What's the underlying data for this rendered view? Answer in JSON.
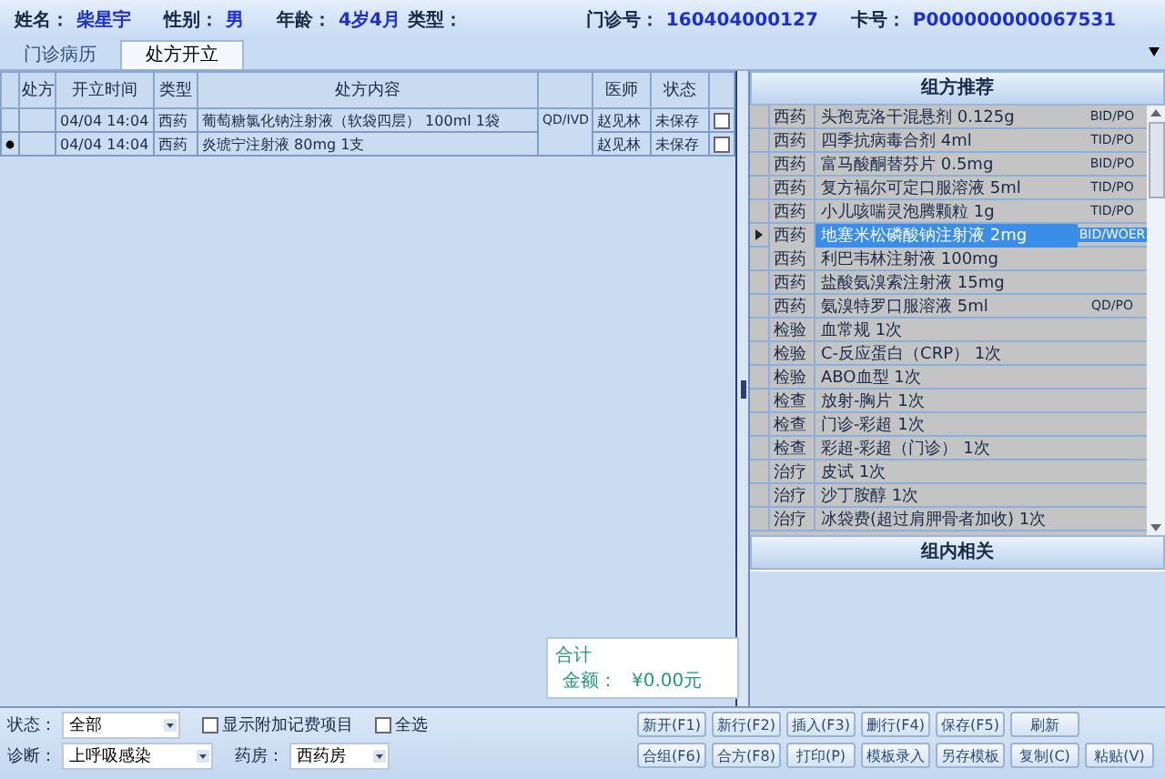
{
  "patient": {
    "name_label": "姓名：",
    "name": "柴星宇",
    "sex_label": "性别：",
    "sex": "男",
    "age_label": "年龄：",
    "age": "4岁4月",
    "type_label": "类型：",
    "clinic_no_label": "门诊号：",
    "clinic_no": "160404000127",
    "card_label": "卡号：",
    "card_no": "P000000000067531"
  },
  "tabs": [
    {
      "label": "门诊病历",
      "selected": false
    },
    {
      "label": "处方开立",
      "selected": true
    }
  ],
  "prescription_table": {
    "columns": [
      "处方",
      "开立时间",
      "类型",
      "处方内容",
      "医师",
      "状态"
    ],
    "rows": [
      {
        "current": false,
        "time": "04/04 14:04",
        "type": "西药",
        "content": "葡萄糖氯化钠注射液（软袋四层）  100ml 1袋",
        "usage": "QD/IVD",
        "doctor": "赵见林",
        "status": "未保存",
        "checked": false
      },
      {
        "current": true,
        "time": "04/04 14:04",
        "type": "西药",
        "content": "炎琥宁注射液  80mg 1支",
        "doctor": "赵见林",
        "status": "未保存",
        "checked": false
      }
    ]
  },
  "total": {
    "label": "合计",
    "amount_label": "金额：",
    "amount": "¥0.00元"
  },
  "recommend": {
    "title": "组方推荐",
    "rows": [
      {
        "type": "西药",
        "content": "头孢克洛干混悬剂  0.125g",
        "usage": "BID/PO",
        "selected": false
      },
      {
        "type": "西药",
        "content": "四季抗病毒合剂  4ml",
        "usage": "TID/PO",
        "selected": false
      },
      {
        "type": "西药",
        "content": "富马酸酮替芬片  0.5mg",
        "usage": "BID/PO",
        "selected": false
      },
      {
        "type": "西药",
        "content": "复方福尔可定口服溶液  5ml",
        "usage": "TID/PO",
        "selected": false
      },
      {
        "type": "西药",
        "content": "小儿咳喘灵泡腾颗粒  1g",
        "usage": "TID/PO",
        "selected": false
      },
      {
        "type": "西药",
        "content": "地塞米松磷酸钠注射液  2mg",
        "usage": "BID/WOER",
        "selected": true
      },
      {
        "type": "西药",
        "content": "利巴韦林注射液  100mg",
        "selected": false
      },
      {
        "type": "西药",
        "content": "盐酸氨溴索注射液  15mg",
        "selected": false
      },
      {
        "type": "西药",
        "content": "氨溴特罗口服溶液  5ml",
        "usage": "QD/PO",
        "selected": false
      },
      {
        "type": "检验",
        "content": "血常规 1次",
        "selected": false
      },
      {
        "type": "检验",
        "content": "C-反应蛋白（CRP） 1次",
        "selected": false
      },
      {
        "type": "检验",
        "content": "ABO血型 1次",
        "selected": false
      },
      {
        "type": "检查",
        "content": "放射-胸片 1次",
        "selected": false
      },
      {
        "type": "检查",
        "content": "门诊-彩超 1次",
        "selected": false
      },
      {
        "type": "检查",
        "content": "彩超-彩超（门诊） 1次",
        "selected": false
      },
      {
        "type": "治疗",
        "content": "皮试 1次",
        "selected": false
      },
      {
        "type": "治疗",
        "content": "沙丁胺醇 1次",
        "selected": false
      },
      {
        "type": "治疗",
        "content": "冰袋费(超过肩胛骨者加收) 1次",
        "selected": false
      }
    ],
    "related_title": "组内相关"
  },
  "filters": {
    "status_label": "状态：",
    "status": "全部",
    "show_extra": {
      "label": "显示附加记费项目",
      "checked": false
    },
    "select_all": {
      "label": "全选",
      "checked": false
    },
    "diagnosis_label": "诊断：",
    "diagnosis": "上呼吸感染",
    "pharmacy_label": "药房：",
    "pharmacy": "西药房"
  },
  "buttons_row1": [
    "新开(F1)",
    "新行(F2)",
    "插入(F3)",
    "删行(F4)",
    "保存(F5)",
    "刷新"
  ],
  "buttons_row2": [
    "合组(F6)",
    "合方(F8)",
    "打印(P)",
    "模板录入",
    "另存模板",
    "复制(C)",
    "粘贴(V)"
  ]
}
